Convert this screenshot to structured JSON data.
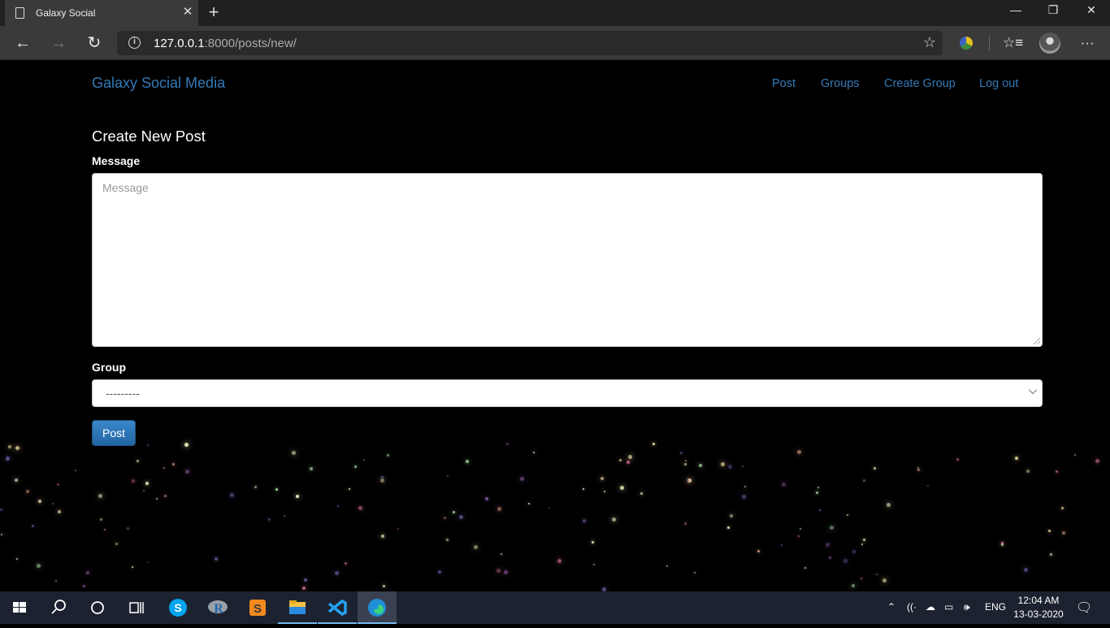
{
  "browser": {
    "tab_title": "Galaxy Social",
    "url_host": "127.0.0.1",
    "url_rest": ":8000/posts/new/"
  },
  "navbar": {
    "brand": "Galaxy Social Media",
    "links": [
      "Post",
      "Groups",
      "Create Group",
      "Log out"
    ]
  },
  "form": {
    "heading": "Create New Post",
    "message_label": "Message",
    "message_placeholder": "Message",
    "group_label": "Group",
    "group_selected": "---------",
    "submit_label": "Post"
  },
  "taskbar": {
    "language": "ENG",
    "time": "12:04 AM",
    "date": "13-03-2020"
  },
  "colors": {
    "link": "#337ab7",
    "button": "#2c74b5",
    "page_bg": "#000000"
  }
}
